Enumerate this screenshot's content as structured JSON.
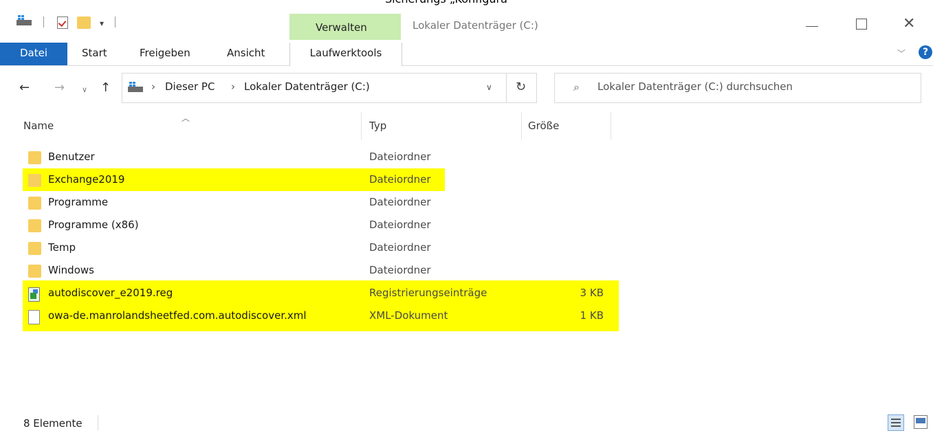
{
  "top_cut_text": "Sicherungs „Konfigura”",
  "title_bar": {
    "window_title": "Lokaler Datenträger (C:)",
    "contextual_tab_group": "Verwalten",
    "qat_dropdown_glyph": "▾"
  },
  "ribbon": {
    "tabs": [
      "Datei",
      "Start",
      "Freigeben",
      "Ansicht",
      "Laufwerktools"
    ],
    "accent_color": "#1b6ac0",
    "contextual_color": "#c9ecb0"
  },
  "navigation": {
    "breadcrumbs": [
      "Dieser PC",
      "Lokaler Datenträger (C:)"
    ],
    "search_placeholder": "Lokaler Datenträger (C:) durchsuchen"
  },
  "columns": {
    "name": "Name",
    "type": "Typ",
    "size": "Größe"
  },
  "files": [
    {
      "name": "Benutzer",
      "type": "Dateiordner",
      "size": "",
      "icon": "folder-icon",
      "highlighted": false
    },
    {
      "name": "Exchange2019",
      "type": "Dateiordner",
      "size": "",
      "icon": "folder-icon",
      "highlighted": true
    },
    {
      "name": "Programme",
      "type": "Dateiordner",
      "size": "",
      "icon": "folder-icon",
      "highlighted": false
    },
    {
      "name": "Programme (x86)",
      "type": "Dateiordner",
      "size": "",
      "icon": "folder-icon",
      "highlighted": false
    },
    {
      "name": "Temp",
      "type": "Dateiordner",
      "size": "",
      "icon": "folder-icon",
      "highlighted": false
    },
    {
      "name": "Windows",
      "type": "Dateiordner",
      "size": "",
      "icon": "folder-icon",
      "highlighted": false
    },
    {
      "name": "autodiscover_e2019.reg",
      "type": "Registrierungseinträge",
      "size": "3 KB",
      "icon": "registry-file-icon",
      "highlighted": true
    },
    {
      "name": "owa-de.manrolandsheetfed.com.autodiscover.xml",
      "type": "XML-Dokument",
      "size": "1 KB",
      "icon": "xml-file-icon",
      "highlighted": true
    }
  ],
  "highlight_color": "#ffff00",
  "status": {
    "item_count": "8 Elemente"
  }
}
